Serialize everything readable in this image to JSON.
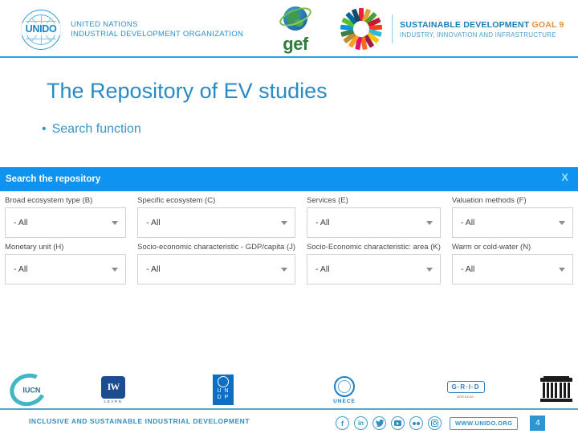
{
  "header": {
    "unido": {
      "emblem_word": "UNIDO",
      "line1": "UNITED NATIONS",
      "line2": "INDUSTRIAL DEVELOPMENT ORGANIZATION"
    },
    "gef": {
      "wordmark": "gef"
    },
    "sdg": {
      "line1_main": "SUSTAINABLE DEVELOPMENT ",
      "line1_goal": "GOAL 9",
      "line2": "INDUSTRY, INNOVATION AND INFRASTRUCTURE",
      "wheel_colors": [
        "#e5243b",
        "#dda63a",
        "#4c9f38",
        "#c5192d",
        "#ff3a21",
        "#26bde2",
        "#fcc30b",
        "#a21942",
        "#fd6925",
        "#dd1367",
        "#fd9d24",
        "#bf8b2e",
        "#3f7e44",
        "#0a97d9",
        "#56c02b",
        "#00689d",
        "#19486a"
      ]
    }
  },
  "slide": {
    "title": "The Repository of EV studies",
    "bullet_marker": "•",
    "bullet_text": "Search function"
  },
  "search_panel": {
    "bar_title": "Search the repository",
    "close_label": "X",
    "fields": [
      {
        "label": "Broad ecosystem type (B)",
        "value": "- All"
      },
      {
        "label": "Specific ecosystem (C)",
        "value": "- All"
      },
      {
        "label": "Services (E)",
        "value": "- All"
      },
      {
        "label": "Valuation methods (F)",
        "value": "- All"
      },
      {
        "label": "Monetary unit (H)",
        "value": "- All"
      },
      {
        "label": "Socio-economic characteristic - GDP/capita (J)",
        "value": "- All"
      },
      {
        "label": "Socio-Economic characteristic: area (K)",
        "value": "- All"
      },
      {
        "label": "Warm or cold-water (N)",
        "value": "- All"
      }
    ],
    "bar_color": "#0e93f0"
  },
  "footer_logos": [
    {
      "name": "IUCN",
      "text": "IUCN"
    },
    {
      "name": "IW-LEARN",
      "text": "IW",
      "sub": "LEARN"
    },
    {
      "name": "UNDP",
      "text": "UNDP",
      "letters": "U N\nD P"
    },
    {
      "name": "UNECE",
      "text": "UNECE"
    },
    {
      "name": "GRID-Arendal",
      "text": "G·R·I·D",
      "sub": "ARENDAL"
    },
    {
      "name": "UNESCO",
      "text": "UNESCO"
    }
  ],
  "bottom_bar": {
    "tagline": "INCLUSIVE AND SUSTAINABLE INDUSTRIAL DEVELOPMENT",
    "social": [
      {
        "icon": "facebook-icon",
        "glyph": "f"
      },
      {
        "icon": "linkedin-icon",
        "glyph": "in"
      },
      {
        "icon": "twitter-icon",
        "glyph": "🐦"
      },
      {
        "icon": "youtube-icon",
        "glyph": ""
      },
      {
        "icon": "flickr-icon",
        "glyph": ""
      },
      {
        "icon": "instagram-icon",
        "glyph": ""
      }
    ],
    "url": "WWW.UNIDO.ORG",
    "page_number": "4",
    "accent": "#2f95d1"
  }
}
